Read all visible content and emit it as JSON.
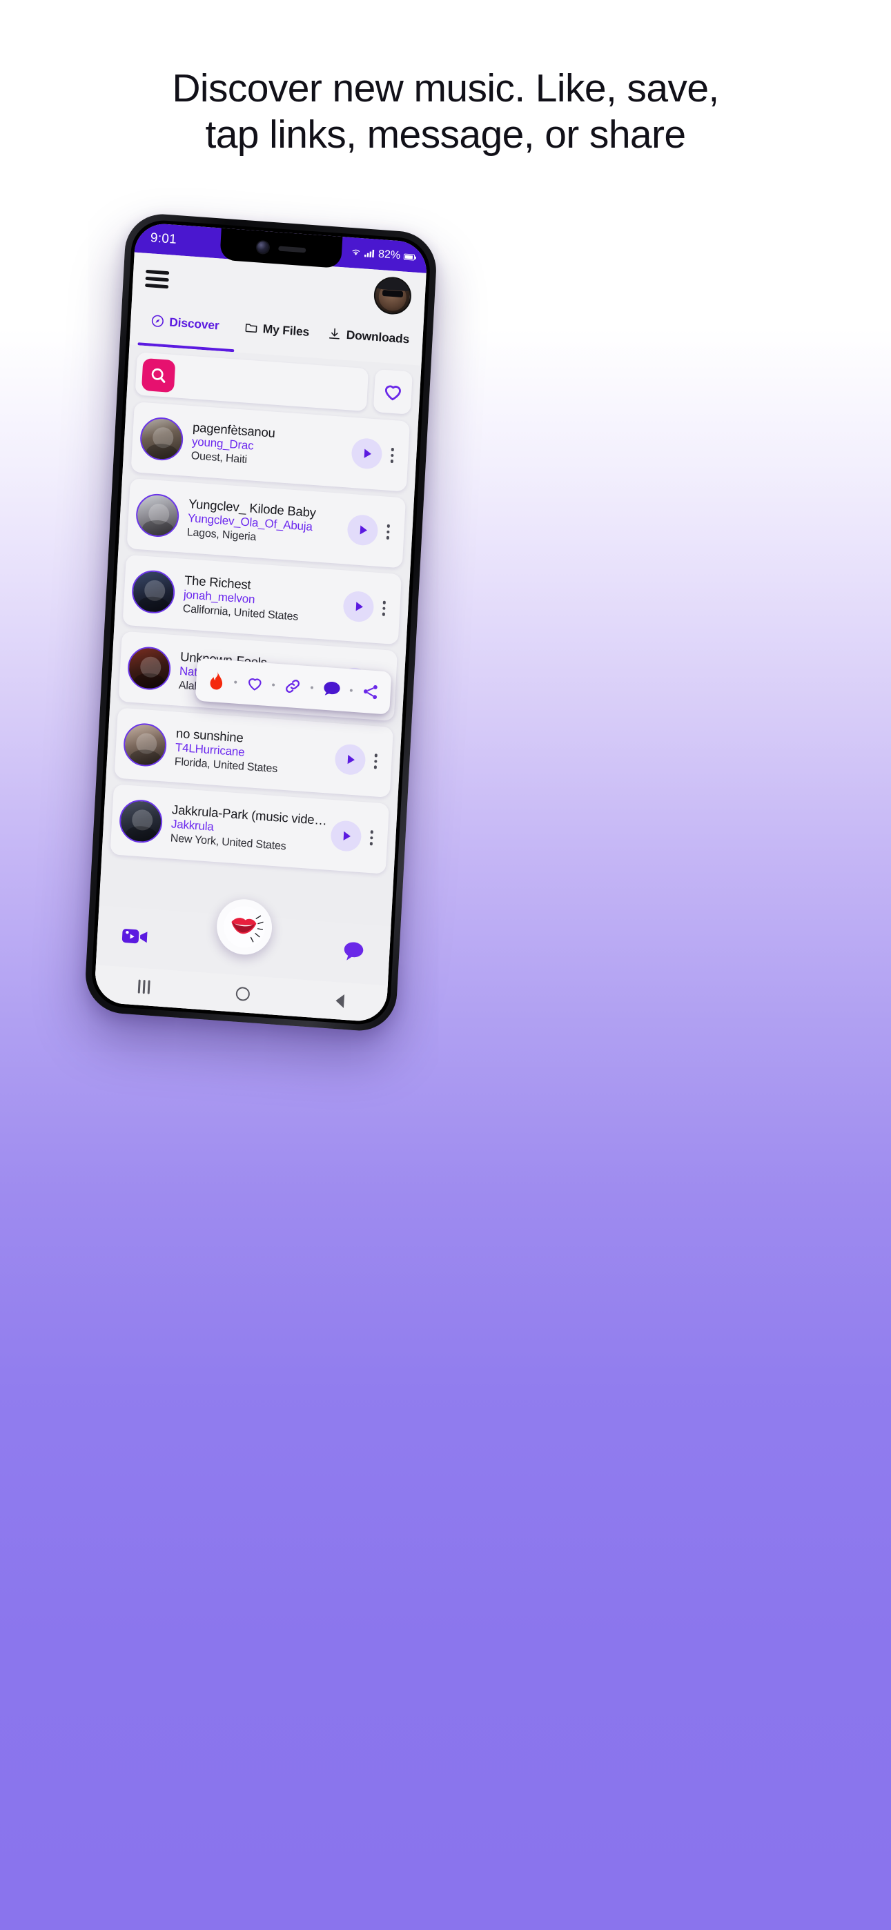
{
  "headline": {
    "line1": "Discover new music. Like, save,",
    "line2": "tap links, message, or share"
  },
  "colors": {
    "brand_purple": "#5b1ae0",
    "status_bar_purple": "#4a17cf",
    "accent_pink": "#e6116f",
    "link_purple": "#6b28ee",
    "page_gradient_bottom": "#8a74ed"
  },
  "status_bar": {
    "clock": "9:01",
    "battery_percent": "82%",
    "wifi_icon": "wifi-icon",
    "signal_icon": "cellular-signal-icon",
    "battery_icon": "battery-icon"
  },
  "app_header": {
    "menu_icon": "hamburger-menu-icon",
    "avatar_icon": "user-avatar"
  },
  "tabs": [
    {
      "label": "Discover",
      "icon": "compass-icon",
      "active": true
    },
    {
      "label": "My Files",
      "icon": "folder-icon",
      "active": false
    },
    {
      "label": "Downloads",
      "icon": "download-arrow-icon",
      "active": false
    }
  ],
  "search": {
    "button_icon": "search-icon",
    "placeholder": "",
    "value": "",
    "favorites_icon": "heart-icon"
  },
  "songs": [
    {
      "title": "pagenfètsanou",
      "user": "young_Drac",
      "location": "Ouest, Haiti",
      "avatar": "p1",
      "play_icon": "play-icon",
      "menu_icon": "kebab-menu-icon"
    },
    {
      "title": "Yungclev_ Kilode Baby",
      "user": "Yungclev_Ola_Of_Abuja",
      "location": "Lagos, Nigeria",
      "avatar": "p2",
      "play_icon": "play-icon",
      "menu_icon": "kebab-menu-icon"
    },
    {
      "title": "The Richest",
      "user": "jonah_melvon",
      "location": "California, United States",
      "avatar": "p3",
      "play_icon": "play-icon",
      "menu_icon": "kebab-menu-icon"
    },
    {
      "title": "Unknown-Feels",
      "user": "Nat1988",
      "location": "Alabama, United States",
      "avatar": "p4",
      "play_icon": "play-icon",
      "menu_icon": "kebab-menu-icon"
    },
    {
      "title": "no sunshine",
      "user": "T4LHurricane",
      "location": "Florida, United States",
      "avatar": "p5",
      "play_icon": "play-icon",
      "menu_icon": "kebab-menu-icon"
    },
    {
      "title": "Jakkrula-Park (music vide…",
      "user": "Jakkrula",
      "location": "New York, United States",
      "avatar": "p6",
      "play_icon": "play-icon",
      "menu_icon": "kebab-menu-icon"
    }
  ],
  "action_popup": {
    "actions": [
      {
        "name": "like-flame-icon",
        "label": "Like"
      },
      {
        "name": "heart-save-icon",
        "label": "Save"
      },
      {
        "name": "link-icon",
        "label": "Link"
      },
      {
        "name": "comment-icon",
        "label": "Message"
      },
      {
        "name": "share-icon",
        "label": "Share"
      }
    ]
  },
  "bottom_bar": {
    "left_icon": "video-camera-icon",
    "center_icon": "lips-sticker-icon",
    "right_icon": "chat-bubble-icon"
  },
  "android_nav": {
    "recents_icon": "recents-icon",
    "home_icon": "home-icon",
    "back_icon": "back-icon"
  }
}
